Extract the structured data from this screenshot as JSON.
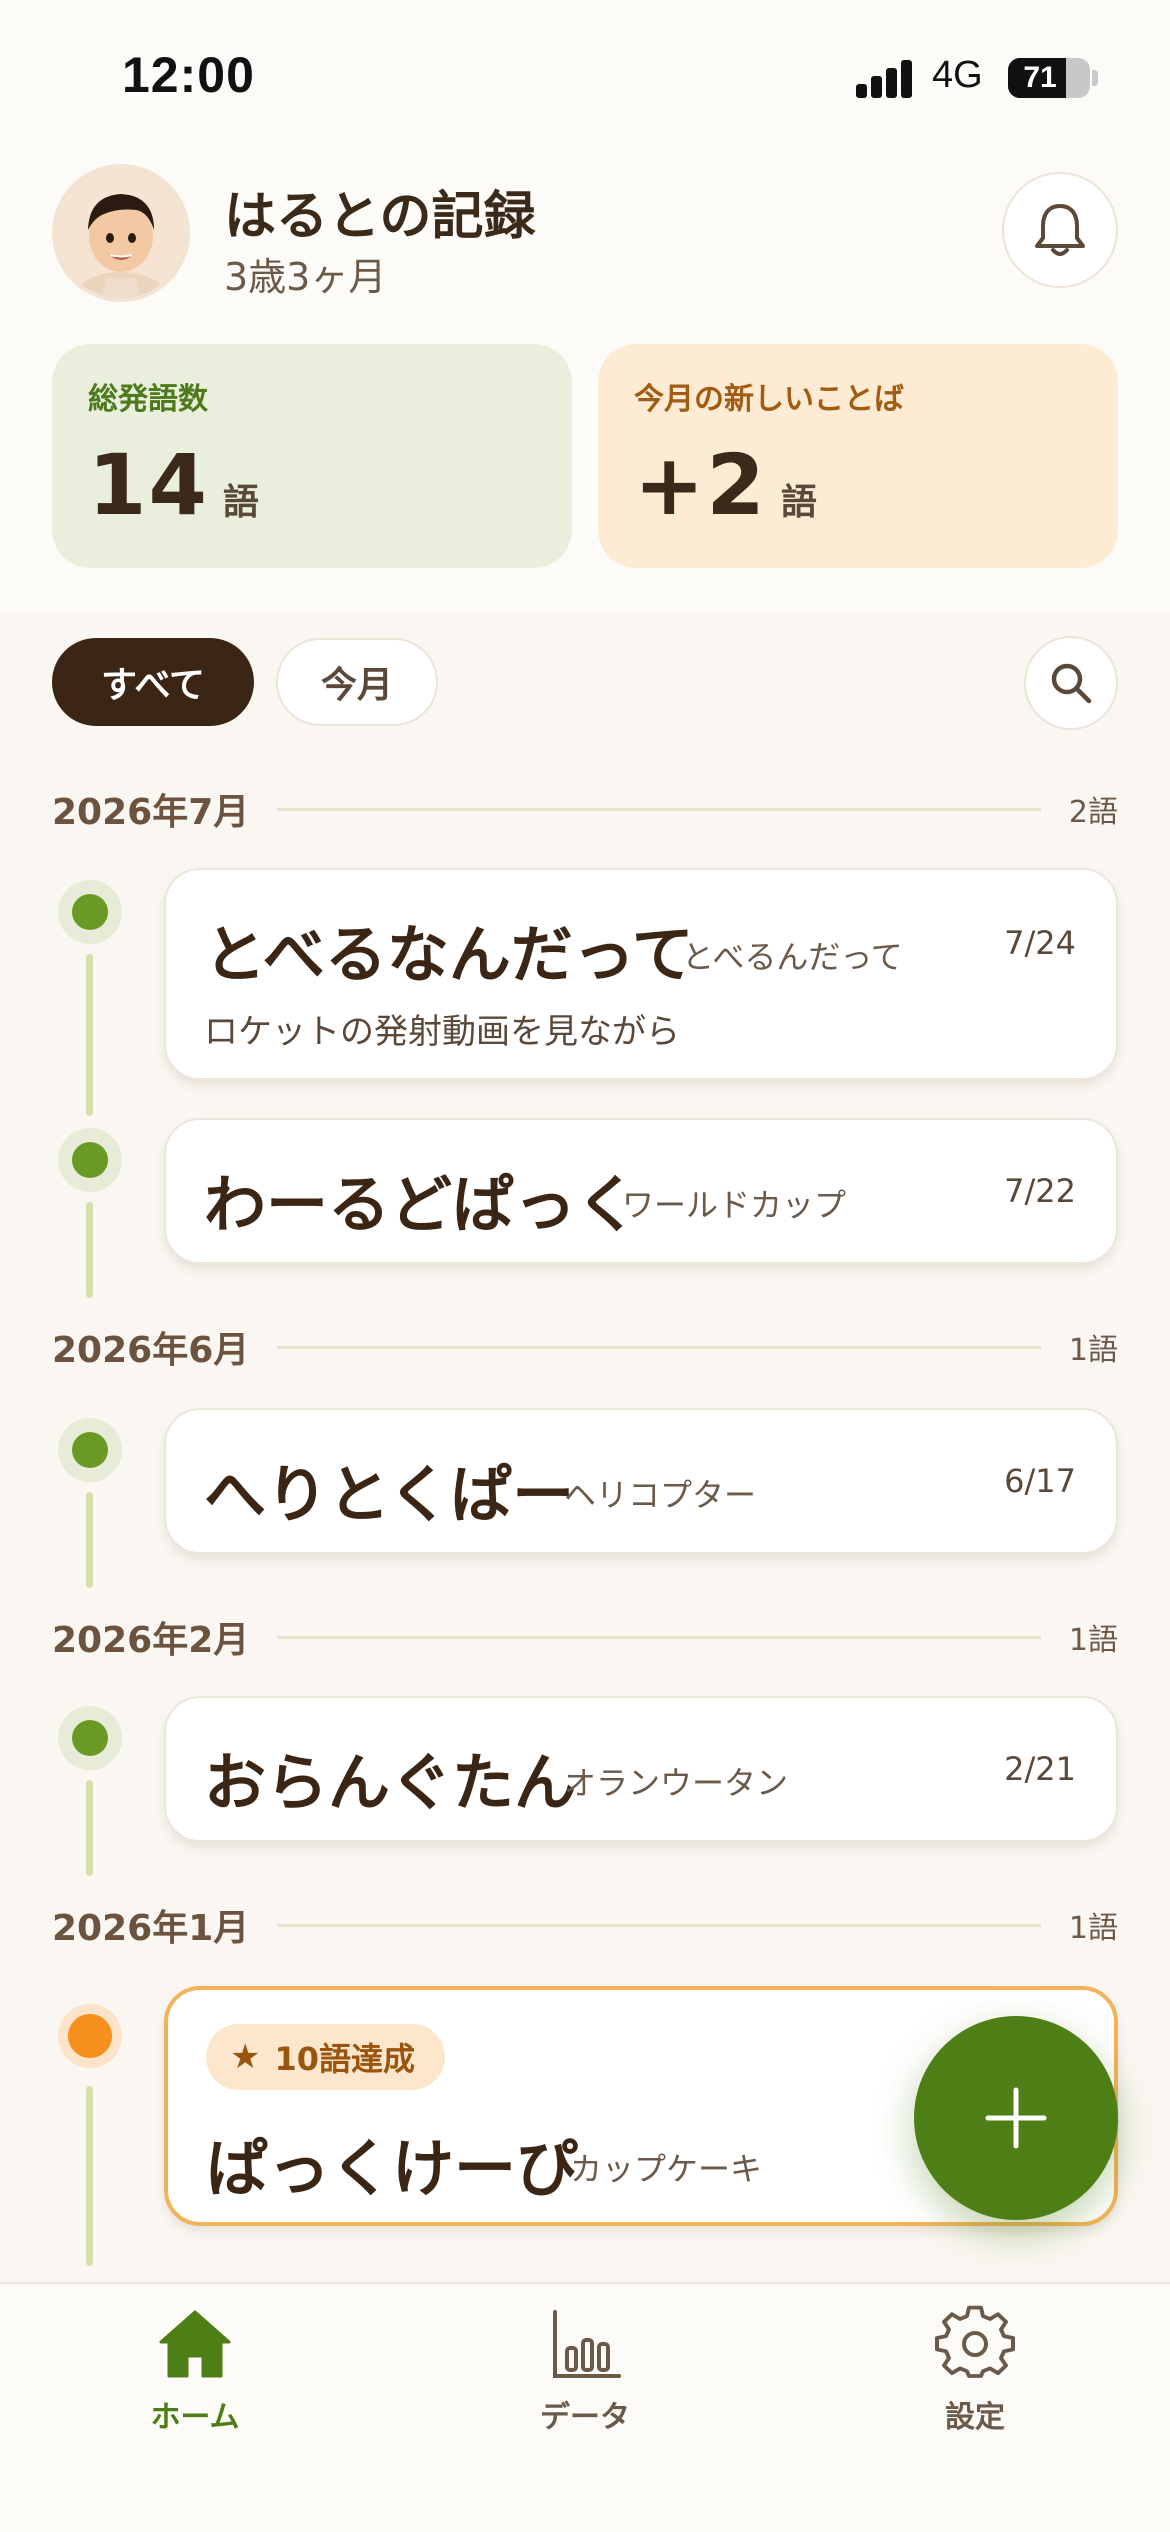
{
  "status_bar": {
    "time": "12:00",
    "network": "4G",
    "battery": "71",
    "battery_level": 0.71
  },
  "header": {
    "title": "はるとの記録",
    "age": "3歳3ヶ月",
    "avatar_icon": "child-photo",
    "bell_icon": "bell-icon"
  },
  "stats": {
    "total": {
      "label": "総発語数",
      "value": "14",
      "unit": "語"
    },
    "month": {
      "label": "今月の新しいことば",
      "value": "+2",
      "unit": "語"
    }
  },
  "filters": {
    "all": "すべて",
    "this_month": "今月",
    "search_icon": "search-icon"
  },
  "months": [
    {
      "label": "2026年7月",
      "count": "2語"
    },
    {
      "label": "2026年6月",
      "count": "1語"
    },
    {
      "label": "2026年2月",
      "count": "1語"
    },
    {
      "label": "2026年1月",
      "count": "1語"
    }
  ],
  "words": [
    {
      "word": "とべるなんだって",
      "reading": "とべるんだって",
      "date": "7/24",
      "note": "ロケットの発射動画を見ながら"
    },
    {
      "word": "わーるどぱっく",
      "reading": "ワールドカップ",
      "date": "7/22"
    },
    {
      "word": "へりとくぱー",
      "reading": "ヘリコプター",
      "date": "6/17"
    },
    {
      "word": "おらんぐたん",
      "reading": "オランウータン",
      "date": "2/21"
    },
    {
      "word": "ぱっくけーぴ",
      "reading": "カップケーキ",
      "badge": "10語達成",
      "badge_icon": "star-icon"
    }
  ],
  "fab": {
    "icon": "plus-icon"
  },
  "nav": [
    {
      "label": "ホーム",
      "icon": "home-icon",
      "active": true
    },
    {
      "label": "データ",
      "icon": "chart-icon",
      "active": false
    },
    {
      "label": "設定",
      "icon": "gear-icon",
      "active": false
    }
  ],
  "colors": {
    "accent": "#4e7e16",
    "milestone": "#f5901e",
    "dark": "#3b2514"
  }
}
